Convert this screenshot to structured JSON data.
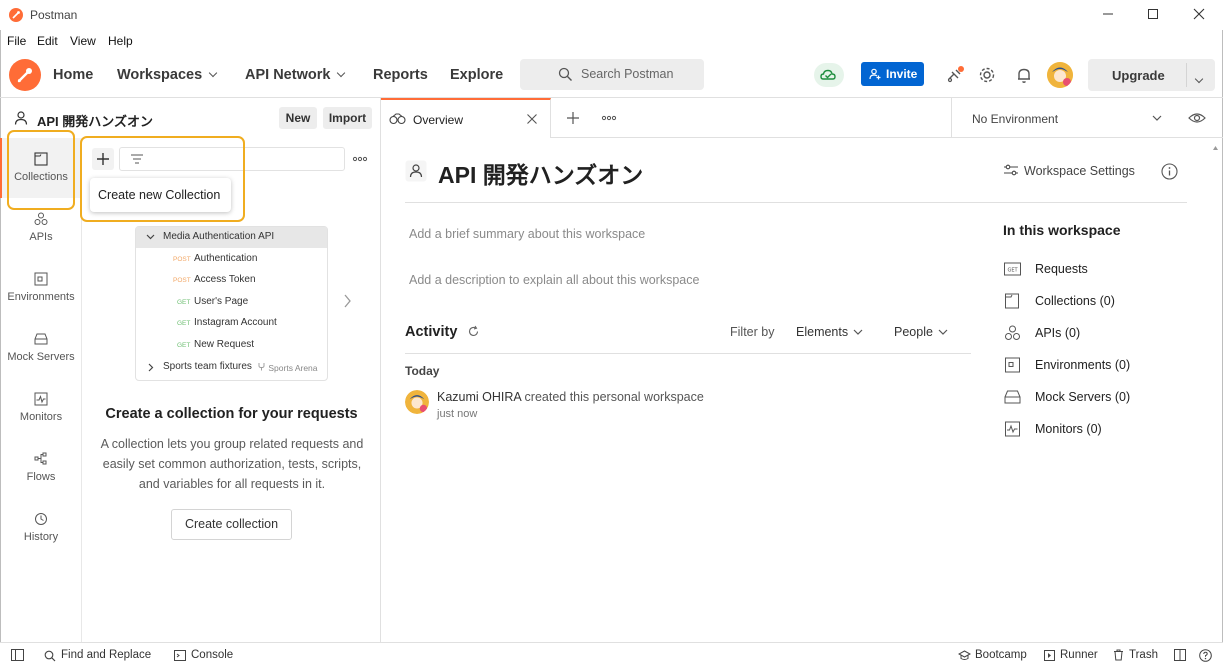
{
  "window": {
    "title": "Postman"
  },
  "menu": [
    "File",
    "Edit",
    "View",
    "Help"
  ],
  "header": {
    "nav": [
      "Home",
      "Workspaces",
      "API Network",
      "Reports",
      "Explore"
    ],
    "search_placeholder": "Search Postman",
    "invite_label": "Invite",
    "upgrade_label": "Upgrade"
  },
  "sidebar": {
    "workspace_name": "API 開発ハンズオン",
    "new_label": "New",
    "import_label": "Import",
    "items": [
      "Collections",
      "APIs",
      "Environments",
      "Mock Servers",
      "Monitors",
      "Flows",
      "History"
    ],
    "tooltip": "Create new Collection",
    "illustration": {
      "collection": "Media Authentication API",
      "requests": [
        {
          "method": "POST",
          "name": "Authentication"
        },
        {
          "method": "POST",
          "name": "Access Token"
        },
        {
          "method": "GET",
          "name": "User's Page"
        },
        {
          "method": "GET",
          "name": "Instagram Account"
        },
        {
          "method": "GET",
          "name": "New Request"
        }
      ],
      "folder": "Sports team fixtures",
      "folder_badge": "Sports Arena"
    },
    "empty_title": "Create a collection for your requests",
    "empty_desc": "A collection lets you group related requests and easily set common authorization, tests, scripts, and variables for all requests in it.",
    "create_button": "Create collection"
  },
  "tabs": {
    "overview_label": "Overview",
    "environment": "No Environment"
  },
  "main": {
    "title": "API 開発ハンズオン",
    "settings_label": "Workspace Settings",
    "summary_placeholder": "Add a brief summary about this workspace",
    "description_placeholder": "Add a description to explain all about this workspace",
    "activity_label": "Activity",
    "filter_by": "Filter by",
    "elements_label": "Elements",
    "people_label": "People",
    "today_label": "Today",
    "activity_user": "Kazumi OHIRA",
    "activity_text": "created this personal workspace",
    "activity_time": "just now",
    "in_workspace_title": "In this workspace",
    "in_workspace": [
      {
        "icon": "request-icon",
        "label": "Requests"
      },
      {
        "icon": "collection-icon",
        "label": "Collections (0)"
      },
      {
        "icon": "api-icon",
        "label": "APIs (0)"
      },
      {
        "icon": "environment-icon",
        "label": "Environments (0)"
      },
      {
        "icon": "mock-server-icon",
        "label": "Mock Servers (0)"
      },
      {
        "icon": "monitor-icon",
        "label": "Monitors (0)"
      }
    ]
  },
  "statusbar": {
    "find_replace": "Find and Replace",
    "console": "Console",
    "bootcamp": "Bootcamp",
    "runner": "Runner",
    "trash": "Trash"
  },
  "colors": {
    "accent": "#ff6c37",
    "invite": "#0265d2",
    "highlight": "#f0ad20"
  }
}
